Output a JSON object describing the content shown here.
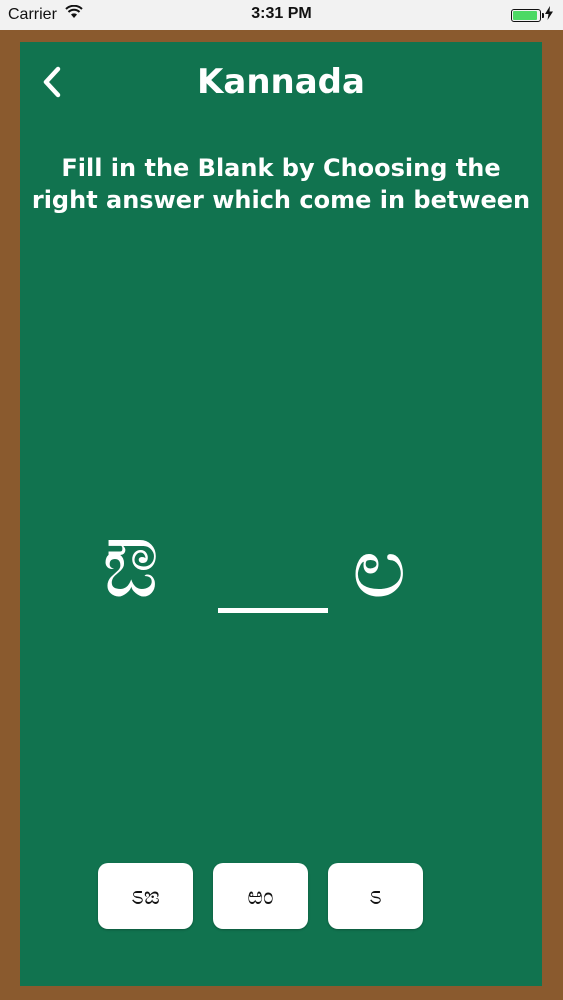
{
  "status_bar": {
    "carrier": "Carrier",
    "time": "3:31 PM",
    "battery_level": 1.0
  },
  "header": {
    "title": "Kannada",
    "back_icon": "chevron-left-icon"
  },
  "instruction": "Fill in the Blank by Choosing the right answer which come in between",
  "question": {
    "left_letter": "ಔ",
    "right_letter": "ಲ"
  },
  "options": [
    {
      "label": "ಽಙ"
    },
    {
      "label": "ಱಂ"
    },
    {
      "label": "ಽ"
    }
  ],
  "colors": {
    "frame": "#11734f",
    "border": "#8a5a2e",
    "text": "#ffffff"
  }
}
